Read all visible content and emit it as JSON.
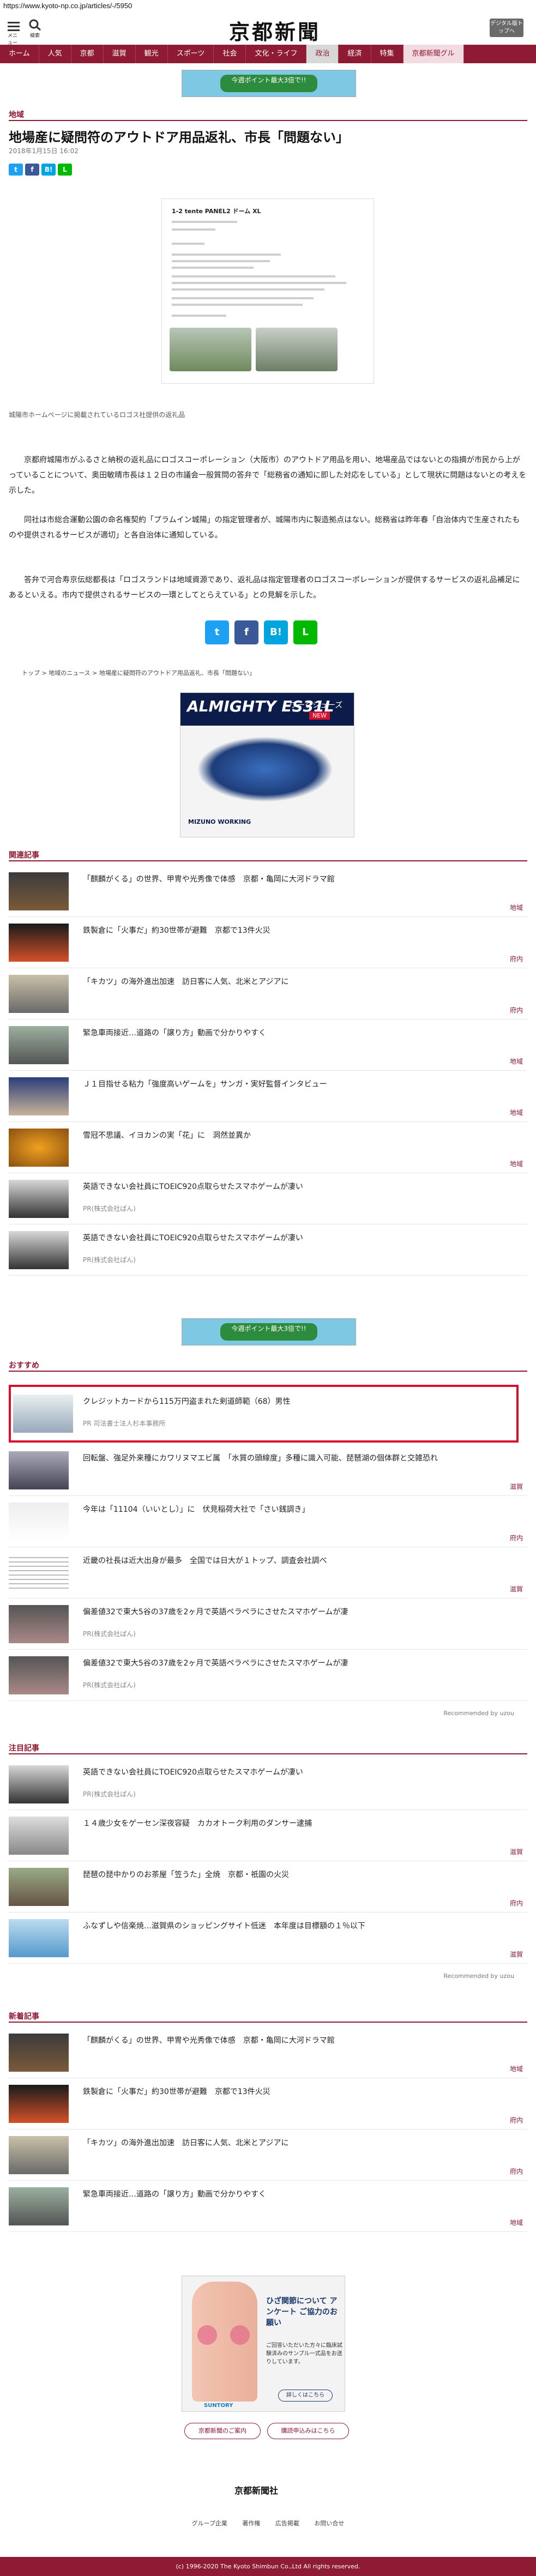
{
  "browser": {
    "url": "https://www.kyoto-np.co.jp/articles/-/5950"
  },
  "header": {
    "menu_label": "メニュー",
    "search_label": "検索",
    "logo": "京都新聞",
    "digital_button": "デジタル版トップへ"
  },
  "nav": {
    "items": [
      "ホーム",
      "人気",
      "京都",
      "滋賀",
      "観光",
      "スポーツ",
      "社会",
      "文化・ライフ",
      "政治",
      "経済",
      "特集",
      "京都新聞グル"
    ],
    "active": "政治"
  },
  "ad_top": {
    "text": "今週ポイント最大3倍で!!"
  },
  "article": {
    "section": "地域",
    "headline": "地場産に疑問符のアウトドア用品返礼、市長「問題ない」",
    "date": "2018年1月15日 16:02",
    "share_small": [
      "Twitter",
      "Facebook",
      "はてな",
      "LINE"
    ],
    "image_doc_title": "1-2 tente PANEL2 ドーム XL",
    "caption": "城陽市ホームページに掲載されているロゴス社提供の返礼品",
    "paragraphs": [
      "京都府城陽市がふるさと納税の返礼品にロゴスコーポレーション（大阪市）のアウトドア用品を用い、地場産品ではないとの指摘が市民から上がっていることについて、奥田敏晴市長は１２日の市議会一般質問の答弁で「総務省の通知に即した対応をしている」として現状に問題はないとの考えを示した。",
      "同社は市総合運動公園の命名権契約「プラムイン城陽」の指定管理者が、城陽市内に製造拠点はない。総務省は昨年春「自治体内で生産されたものや提供されるサービスが適切」と各自治体に通知している。",
      "答弁で河合寿京伝総都長は「ロゴスランドは地域資源であり、返礼品は指定管理者のロゴスコーポレーションが提供するサービスの返礼品補足にあるといえる。市内で提供されるサービスの一環としてとらえている」との見解を示した。"
    ],
    "share_big": [
      "Twitter",
      "Facebook",
      "B!",
      "LINE"
    ],
    "breadcrumb": [
      "トップ",
      "地域のニュース",
      "地場産に疑問符のアウトドア用品返礼、市長「問題ない」"
    ]
  },
  "mizuno_ad": {
    "brand": "ALMIGHTY ES31L",
    "kana": "ワークシューズ",
    "badge": "NEW",
    "footer": "MIZUNO WORKING"
  },
  "related": {
    "label": "関連記事",
    "items": [
      {
        "title": "「麒麟がくる」の世界、甲冑や光秀像で体感　京都・亀岡に大河ドラマ館",
        "tag": "地域"
      },
      {
        "title": "鉄製倉に「火事だ」約30世帯が避難　京都で13件火災",
        "tag": "府内"
      },
      {
        "title": "「キカツ」の海外進出加速　訪日客に人気、北米とアジアに",
        "tag": "府内"
      },
      {
        "title": "緊急車両接近…道路の「譲り方」動画で分かりやすく",
        "tag": "地域"
      },
      {
        "title": "Ｊ１目指せる粘力「強度高いゲームを」サンガ・実好監督インタビュー",
        "tag": "地域"
      },
      {
        "title": "雪冠不思議、イヨカンの実「花」に　洞然並異か",
        "tag": "地域"
      },
      {
        "title": "英語できない会社員にTOEIC920点取らせたスマホゲームが凄い",
        "pr": "PR(株式会社ぱん)"
      },
      {
        "title": "英語できない会社員にTOEIC920点取らせたスマホゲームが凄い",
        "pr": "PR(株式会社ぱん)"
      }
    ]
  },
  "ad_mid": {
    "text": "今週ポイント最大3倍で!!"
  },
  "recommend": {
    "label": "おすすめ",
    "items": [
      {
        "title": "クレジットカードから115万円盗まれた剣道師範（68）男性",
        "pr": "PR 司法書士法人杉本事務所"
      },
      {
        "title": "回転盤、強足外来種にカワリヌマエビ属　「水質の頭線度」多種に識入可能、琵琶湖の個体群と交雑恐れ",
        "tag": "滋賀"
      },
      {
        "title": "今年は「11104（いいとし）」に　伏見稲荷大社で「さい銭調き」",
        "tag": "府内"
      },
      {
        "title": "近畿の社長は近大出身が最多　全国では日大が１トップ、調査会社調べ",
        "tag": "滋賀"
      },
      {
        "title": "偏差値32で東大5谷の37歳を2ヶ月で英語ペラペラにさせたスマホゲームが凄",
        "pr": "PR(株式会社ぱん)"
      },
      {
        "title": "偏差値32で東大5谷の37歳を2ヶ月で英語ペラペラにさせたスマホゲームが凄",
        "pr": "PR(株式会社ぱん)"
      }
    ],
    "powered": "Recommended by uzou"
  },
  "attention": {
    "label": "注目記事",
    "items": [
      {
        "title": "英語できない会社員にTOEIC920点取らせたスマホゲームが凄い",
        "pr": "PR(株式会社ぱん)"
      },
      {
        "title": "１４歳少女をゲーセン深夜容疑　カカオトーク利用のダンサー逮捕",
        "tag": "滋賀"
      },
      {
        "title": "琵琶の琵中かりのお茶屋「笠うた」全焼　京都・祇園の火災",
        "tag": "府内"
      },
      {
        "title": "ふなずしや信楽焼…滋賀県のショッピングサイト低迷　本年度は目標額の１％以下",
        "tag": "滋賀"
      }
    ],
    "powered": "Recommended by uzou"
  },
  "latest": {
    "label": "新着記事",
    "items": [
      {
        "title": "「麒麟がくる」の世界、甲冑や光秀像で体感　京都・亀岡に大河ドラマ館",
        "tag": "地域"
      },
      {
        "title": "鉄製倉に「火事だ」約30世帯が避難　京都で13件火災",
        "tag": "府内"
      },
      {
        "title": "「キカツ」の海外進出加速　訪日客に人気、北米とアジアに",
        "tag": "府内"
      },
      {
        "title": "緊急車両接近…道路の「譲り方」動画で分かりやすく",
        "tag": "地域"
      }
    ]
  },
  "dot_ad": {
    "headline": "ひざ関節について アンケート ご協力のお願い",
    "body": "ご回答いただいた方々に臨床試験済みのサンプル一式品をお送りしています。",
    "button": "詳しくはこちら",
    "brand": "SUNTORY"
  },
  "footer": {
    "buttons": [
      "京都新聞のご案内",
      "購読申込みはこちら"
    ],
    "logo": "京都新聞社",
    "nav": [
      "グループ企業",
      "著作権",
      "広告掲載",
      "お問い合せ"
    ],
    "copyright": "(c) 1996-2020 The Kyoto Shimbun Co.,Ltd All rights reserved."
  }
}
